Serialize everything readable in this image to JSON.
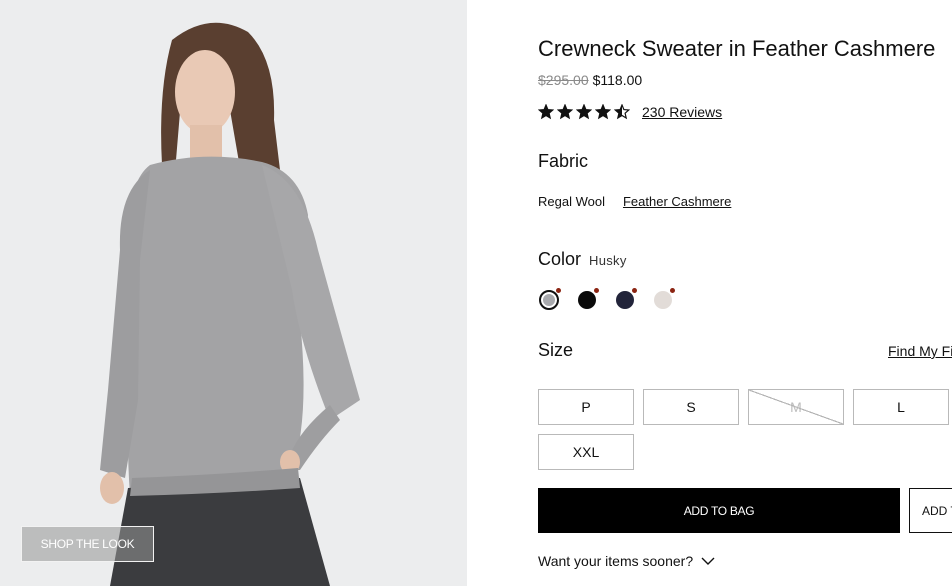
{
  "product": {
    "title": "Crewneck Sweater in Feather Cashmere",
    "original_price": "$295.00",
    "sale_price": "$118.00",
    "rating": 4.5,
    "rating_max": 5,
    "reviews_label": "230 Reviews"
  },
  "image": {
    "shop_the_look_label": "SHOP THE LOOK"
  },
  "fabric": {
    "label": "Fabric",
    "options": [
      "Regal Wool",
      "Feather Cashmere"
    ],
    "selected": "Feather Cashmere"
  },
  "color": {
    "label": "Color",
    "selected_name": "Husky",
    "swatches": [
      {
        "color": "#a9aaae",
        "selected": true
      },
      {
        "color": "#0a0a0a",
        "selected": false
      },
      {
        "color": "#22243a",
        "selected": false
      },
      {
        "color": "#e2dcd8",
        "selected": false
      }
    ],
    "flag_color": "#8b2412"
  },
  "size": {
    "label": "Size",
    "guide_label": "Find My Fit",
    "options": [
      {
        "label": "P",
        "available": true
      },
      {
        "label": "S",
        "available": true
      },
      {
        "label": "M",
        "available": false
      },
      {
        "label": "L",
        "available": true
      },
      {
        "label": "XXL",
        "available": true
      }
    ]
  },
  "actions": {
    "add_to_bag": "ADD TO BAG",
    "secondary": "ADD TO"
  },
  "delivery": {
    "sooner_label": "Want your items sooner?"
  }
}
